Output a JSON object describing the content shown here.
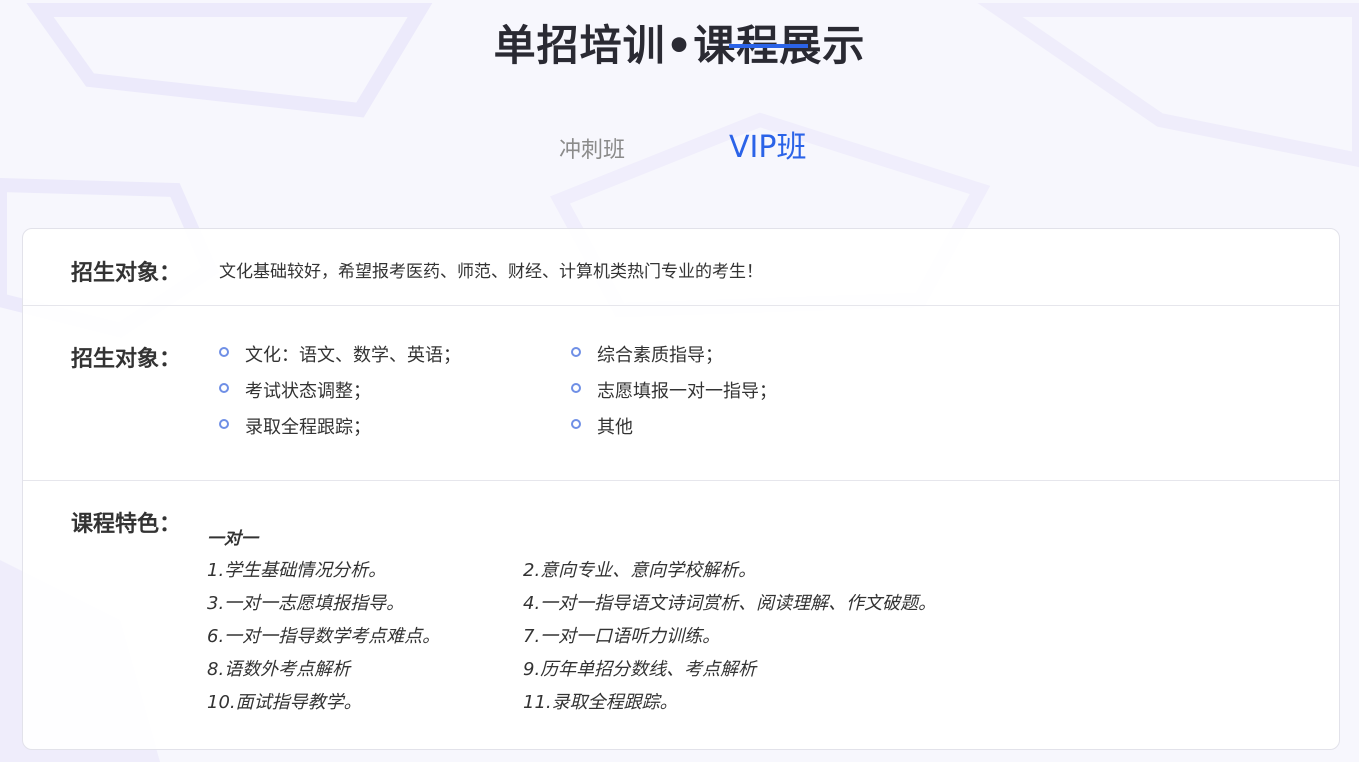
{
  "header": {
    "title": "单招培训•课程展示"
  },
  "tabs": [
    {
      "label": "冲刺班",
      "active": false
    },
    {
      "label": "VIP班",
      "active": true
    }
  ],
  "colors": {
    "accent": "#2b63e8",
    "bullet": "#6f8fe6",
    "text": "#333333"
  },
  "sections": {
    "target": {
      "label": "招生对象：",
      "text": "文化基础较好，希望报考医药、师范、财经、计算机类热门专业的考生！"
    },
    "content": {
      "label": "招生对象：",
      "items": [
        "文化：语文、数学、英语；",
        "综合素质指导；",
        "考试状态调整；",
        "志愿填报一对一指导；",
        "录取全程跟踪；",
        "其他"
      ]
    },
    "features": {
      "label": "课程特色：",
      "heading": "一对一",
      "items": [
        "1.学生基础情况分析。",
        "2.意向专业、意向学校解析。",
        "3.一对一志愿填报指导。",
        "4.一对一指导语文诗词赏析、阅读理解、作文破题。",
        "6.一对一指导数学考点难点。",
        "7.一对一口语听力训练。",
        "8.语数外考点解析",
        "9.历年单招分数线、考点解析",
        "10.面试指导教学。",
        "11.录取全程跟踪。"
      ]
    }
  }
}
